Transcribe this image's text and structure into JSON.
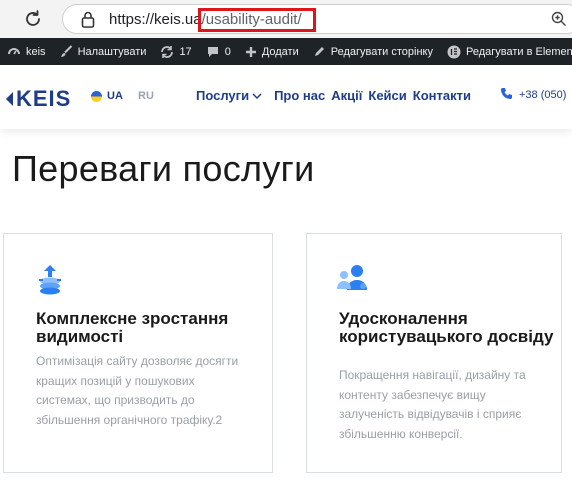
{
  "browser": {
    "url_base": "https://keis.ua",
    "url_path": "/usability-audit/"
  },
  "adminbar": {
    "site_name": "keis",
    "customize": "Налаштувати",
    "updates_count": "17",
    "comments_count": "0",
    "add_new": "Додати",
    "edit_page": "Редагувати сторінку",
    "edit_elementor": "Редагувати в Elementor"
  },
  "header": {
    "logo_text": "KEIS",
    "lang_active": "UA",
    "lang_other": "RU",
    "nav": {
      "services": "Послуги",
      "about": "Про нас",
      "promotions": "Акції",
      "cases": "Кейси",
      "contacts": "Контакти"
    },
    "phone": "+38 (050)"
  },
  "main": {
    "title": "Переваги послуги",
    "cards": [
      {
        "icon": "growth-stack-icon",
        "title": "Комплексне зростання видимості",
        "text": "Оптимізація сайту дозволяє досягти кращих позицій у пошукових системах, що призводить до збільшення органічного трафіку.2"
      },
      {
        "icon": "users-icon",
        "title": "Удосконалення користувацького досвіду",
        "text": "Покращення навігації, дизайну та контенту забезпечує вищу залученість відвідувачів і сприяє збільшенню конверсії."
      }
    ]
  },
  "colors": {
    "brand": "#1f3c88",
    "icon_blue": "#2b7ff0",
    "highlight": "#e0141b",
    "admin_bg": "#1d2327"
  }
}
